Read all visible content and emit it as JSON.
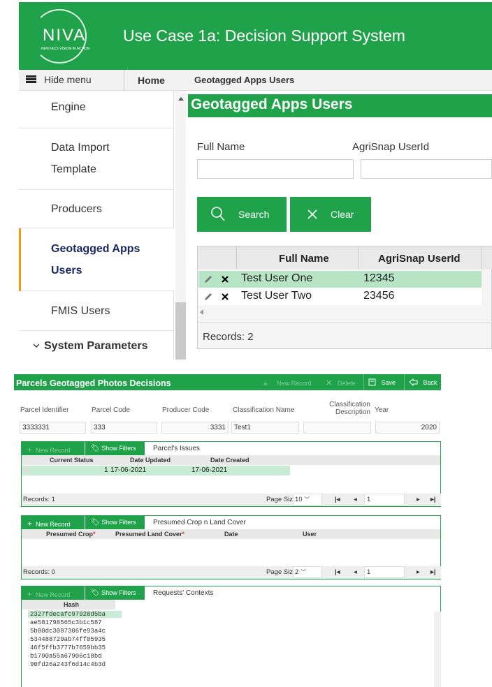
{
  "top": {
    "logo": {
      "text": "NIVA",
      "subtitle": "NEW IACS VISION IN ACTION"
    },
    "app_title": "Use Case 1a: Decision Support System",
    "nav": {
      "hide_menu": "Hide menu",
      "home": "Home",
      "breadcrumb": "Geotagged Apps Users"
    },
    "sidebar": {
      "items": [
        {
          "label": "Engine"
        },
        {
          "label": "Data Import Template"
        },
        {
          "label": "Producers"
        },
        {
          "label": "Geotagged Apps Users"
        },
        {
          "label": "FMIS Users"
        },
        {
          "label": "System Parameters"
        }
      ]
    },
    "page_title": "Geotagged Apps Users",
    "filters": {
      "full_name_label": "Full Name",
      "full_name_value": "",
      "userid_label": "AgriSnap UserId",
      "userid_value": ""
    },
    "buttons": {
      "search": "Search",
      "clear": "Clear"
    },
    "grid": {
      "columns": [
        "Full Name",
        "AgriSnap UserId"
      ],
      "rows": [
        {
          "full_name": "Test User One",
          "userid": "12345"
        },
        {
          "full_name": "Test User Two",
          "userid": "23456"
        }
      ],
      "records": "Records: 2"
    }
  },
  "bottom": {
    "title": "Parcels Geotagged Photos Decisions",
    "toolbar": {
      "new_record": "New Record",
      "delete": "Delete",
      "save": "Save",
      "back": "Back"
    },
    "header_fields": {
      "labels": [
        "Parcel Identifier",
        "Parcel Code",
        "Producer Code",
        "Classification Name",
        "Classification Description",
        "Year"
      ],
      "values": [
        "3333331",
        "333",
        "3331",
        "Test1",
        "",
        "2020"
      ]
    },
    "issues": {
      "new_record": "New Record",
      "show_filters": "Show Filters",
      "title": "Parcel's Issues",
      "columns": [
        "Current Status",
        "Date Updated",
        "Date Created"
      ],
      "rows": [
        {
          "status": "1",
          "updated": "17-06-2021",
          "created": "17-06-2021"
        }
      ],
      "records": "Records: 1",
      "page_size_label": "Page Size:",
      "page_size": "10",
      "page": "1"
    },
    "crops": {
      "new_record": "New Record",
      "show_filters": "Show Filters",
      "title": "Presumed Crop n Land Cover",
      "columns": [
        "Presumed Crop",
        "Presumed Land Cover",
        "Date",
        "User"
      ],
      "required_mark": "*",
      "records": "Records: 0",
      "page_size_label": "Page Size:",
      "page_size": "2",
      "page": "1"
    },
    "requests": {
      "new_record": "New Record",
      "show_filters": "Show Filters",
      "title": "Requests' Contexts",
      "column": "Hash",
      "hashes": [
        "2327fdecafc97928d5ba",
        "ae581798565c3b1c587",
        "5b80dc3087306fe93a4c",
        "534488729ab74ff05935",
        "46f5ffb3777b7659bb35",
        "b1790a55a67906c18bd",
        "90fd26a243f6d14c4b3d"
      ]
    },
    "icons": {
      "search": "search-icon",
      "clear": "x-icon",
      "pencil": "pencil-icon",
      "delete": "delete-x-icon",
      "tag": "tag-icon",
      "save": "save-icon",
      "back": "back-icon"
    },
    "colors": {
      "brand_green": "#1fa24a",
      "selected_row": "#c7ebd3",
      "active_accent": "#f39c12"
    }
  }
}
